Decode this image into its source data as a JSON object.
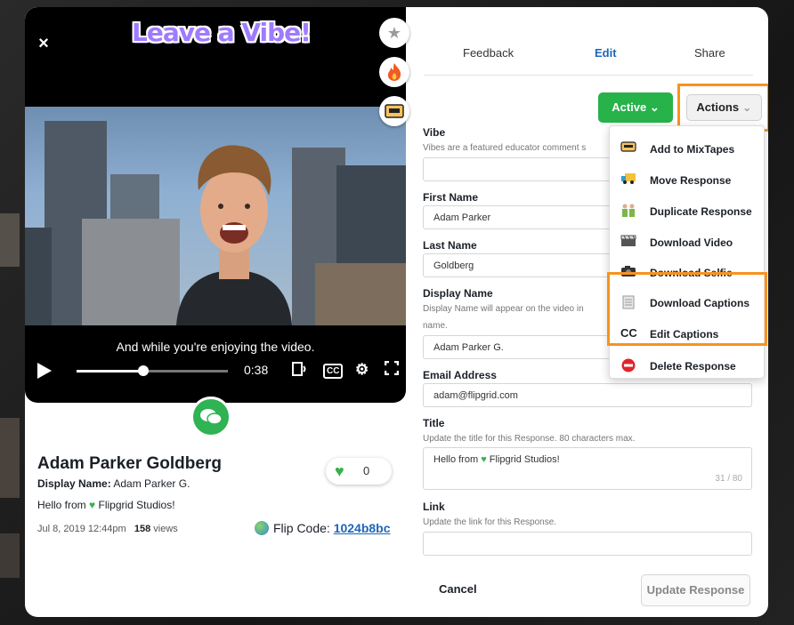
{
  "video": {
    "title": "Leave a Vibe!",
    "close_glyph": "×",
    "caption": "And while you're enjoying the video.",
    "time": "0:38",
    "progress_fraction": 0.44,
    "cc_label": "CC"
  },
  "response": {
    "name": "Adam Parker Goldberg",
    "display_label": "Display Name:",
    "display_value": "Adam Parker G.",
    "message_prefix": "Hello from",
    "message_suffix": "Flipgrid Studios!",
    "date": "Jul 8, 2019 12:44pm",
    "views_count": "158",
    "views_label": "views",
    "likes": "0",
    "flip_code_label": "Flip Code:",
    "flip_code": "1024b8bc"
  },
  "tabs": [
    {
      "label": "Feedback"
    },
    {
      "label": "Edit"
    },
    {
      "label": "Share"
    }
  ],
  "buttons": {
    "active_label": "Active",
    "actions_label": "Actions",
    "cancel_label": "Cancel",
    "update_label": "Update Response"
  },
  "form": {
    "vibe_label": "Vibe",
    "vibe_help": "Vibes are a featured educator comment s",
    "first_name_label": "First Name",
    "first_name_value": "Adam Parker",
    "last_name_label": "Last Name",
    "last_name_value": "Goldberg",
    "display_name_label": "Display Name",
    "display_name_help": "Display Name will appear on the video in",
    "display_name_help2": "name.",
    "display_name_value": "Adam Parker G.",
    "email_label": "Email Address",
    "email_value": "adam@flipgrid.com",
    "title_label": "Title",
    "title_help": "Update the title for this Response. 80 characters max.",
    "title_prefix": "Hello from",
    "title_suffix": "Flipgrid Studios!",
    "title_counter": "31 / 80",
    "link_label": "Link",
    "link_help": "Update the link for this Response."
  },
  "actions_menu": [
    {
      "label": "Add to MixTapes",
      "icon": "mixtape-icon"
    },
    {
      "label": "Move Response",
      "icon": "truck-icon"
    },
    {
      "label": "Duplicate Response",
      "icon": "duplicate-icon"
    },
    {
      "label": "Download Video",
      "icon": "clapperboard-icon"
    },
    {
      "label": "Download Selfie",
      "icon": "camera-icon"
    },
    {
      "label": "Download Captions",
      "icon": "document-icon"
    },
    {
      "label": "Edit Captions",
      "icon": "cc-icon"
    },
    {
      "label": "Delete Response",
      "icon": "no-entry-icon"
    }
  ],
  "colors": {
    "accent_green": "#27b24a",
    "link_blue": "#1d66b9",
    "highlight_orange": "#f7931e",
    "vibe_purple": "#9f7bff"
  }
}
